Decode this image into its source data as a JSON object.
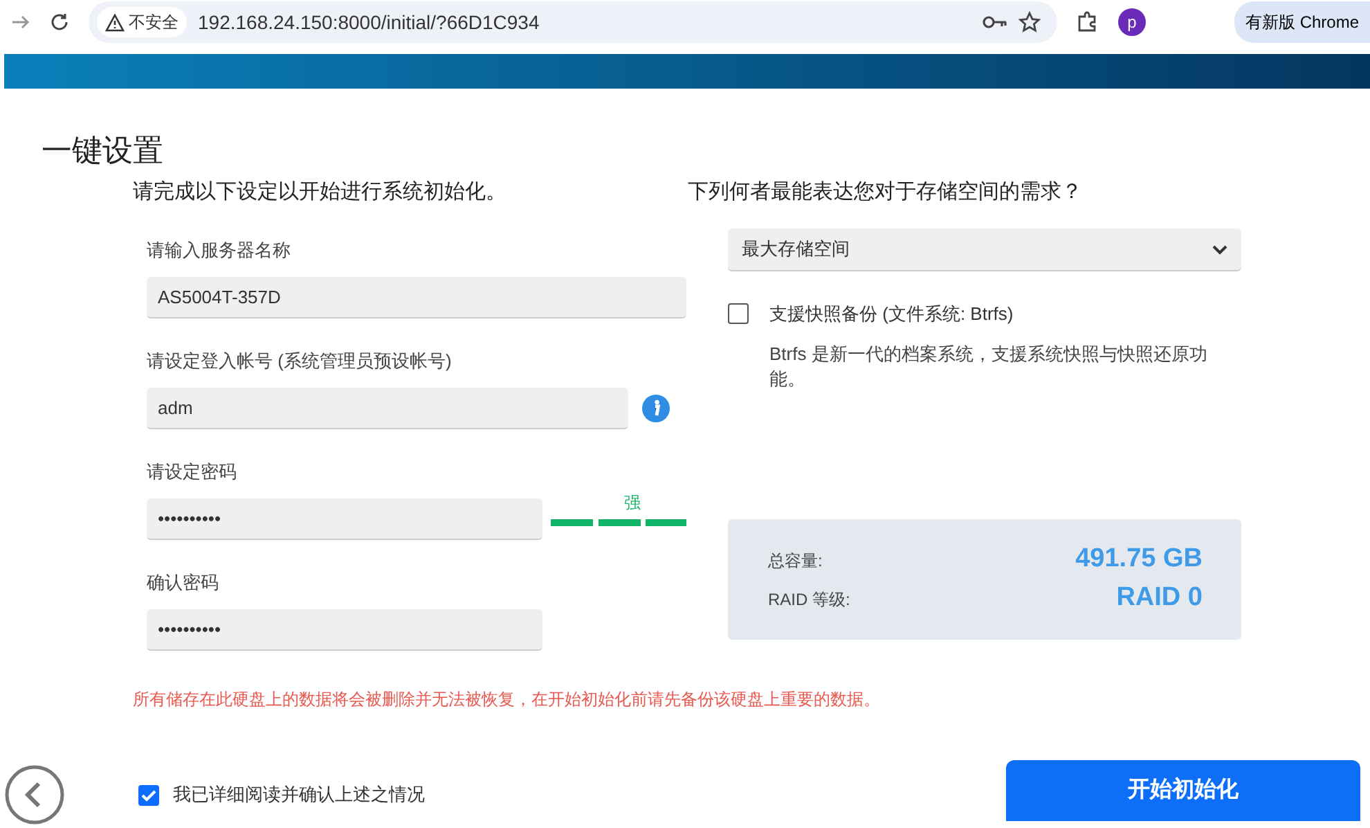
{
  "browser": {
    "security_label": "不安全",
    "url": "192.168.24.150:8000/initial/?66D1C934",
    "profile_initial": "p",
    "update_button": "有新版 Chrome"
  },
  "page_title": "一键设置",
  "left": {
    "heading": "请完成以下设定以开始进行系统初始化。",
    "fields": [
      {
        "kind": "text",
        "label": "请输入服务器名称",
        "value": "AS5004T-357D"
      },
      {
        "kind": "info",
        "label": "请设定登入帐号 (系统管理员预设帐号)",
        "value": "adm"
      },
      {
        "kind": "strength",
        "label": "请设定密码",
        "value": "••••••••••",
        "strength_label": "强",
        "level": 1
      },
      {
        "kind": "password",
        "label": "确认密码",
        "value": "••••••••••"
      }
    ]
  },
  "right": {
    "heading": "下列何者最能表达您对于存储空间的需求？",
    "select_value": "最大存储空间",
    "snapshot": {
      "label": "支援快照备份 (文件系统: Btrfs)",
      "checked": false,
      "description": "Btrfs 是新一代的档案系统，支援系统快照与快照还原功能。"
    },
    "summary": [
      {
        "label": "总容量:",
        "value": "491.75 GB"
      },
      {
        "label": "RAID 等级:",
        "value": "RAID 0"
      }
    ]
  },
  "warning": "所有储存在此硬盘上的数据将会被删除并无法被恢复，在开始初始化前请先备份该硬盘上重要的数据。",
  "confirm": {
    "label": "我已详细阅读并确认上述之情况",
    "checked": true
  },
  "start_button": "开始初始化"
}
